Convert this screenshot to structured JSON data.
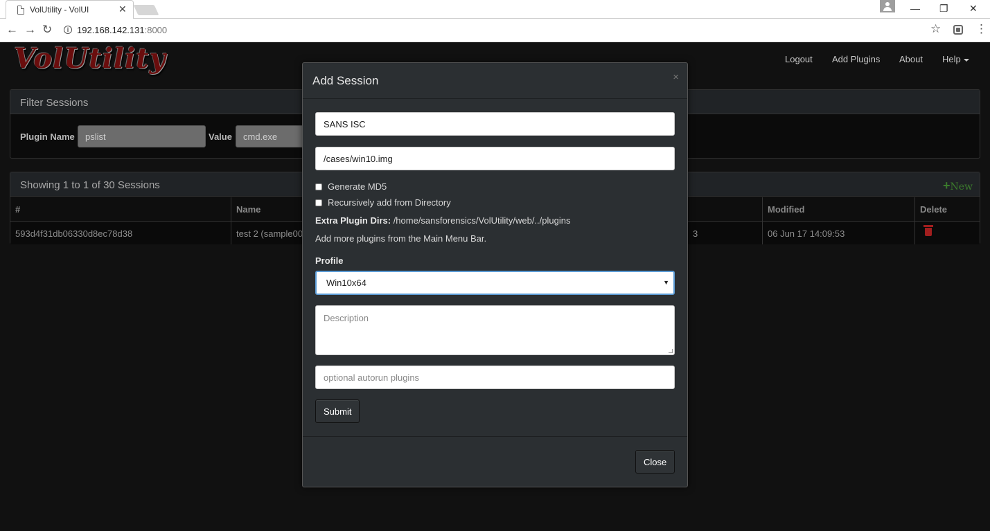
{
  "browser": {
    "tab_title": "VolUtility - VolUI",
    "tab_close": "✕",
    "url_host": "192.168.142.131",
    "url_port": ":8000",
    "back": "←",
    "forward": "→",
    "reload": "↻",
    "info": "i",
    "star": "☆",
    "menu": "⋮",
    "minimize": "—",
    "restore": "❐",
    "close": "✕"
  },
  "app": {
    "logo": "VolUtility",
    "nav": {
      "logout": "Logout",
      "add_plugins": "Add Plugins",
      "about": "About",
      "help": "Help"
    }
  },
  "filter": {
    "title": "Filter Sessions",
    "plugin_label": "Plugin Name",
    "plugin_value": "pslist",
    "value_label": "Value",
    "value_value": "cmd.exe"
  },
  "sessions": {
    "summary": "Showing 1 to 1 of 30 Sessions",
    "new_label": "New",
    "new_plus": "+",
    "columns": {
      "id": "#",
      "name": "Name",
      "modified": "Modified",
      "delete": "Delete"
    },
    "rows": [
      {
        "id": "593d4f31db06330d8ec78d38",
        "name": "test 2 (sample00",
        "partial": "3",
        "modified": "06 Jun 17 14:09:53"
      }
    ]
  },
  "modal": {
    "title": "Add Session",
    "close_x": "×",
    "session_name_value": "SANS ISC",
    "path_value": "/cases/win10.img",
    "generate_md5": "Generate MD5",
    "recursive": "Recursively add from Directory",
    "extra_dirs_label": "Extra Plugin Dirs:",
    "extra_dirs_value": " /home/sansforensics/VolUtility/web/../plugins",
    "add_more_hint": "Add more plugins from the Main Menu Bar.",
    "profile_label": "Profile",
    "profile_selected": "Win10x64",
    "description_placeholder": "Description",
    "autorun_placeholder": "optional autorun plugins",
    "submit_label": "Submit",
    "close_label": "Close"
  },
  "colors": {
    "accent_focus": "#5b9bd5",
    "new_green": "#3b7a2c",
    "delete_red": "#a11e1e"
  }
}
